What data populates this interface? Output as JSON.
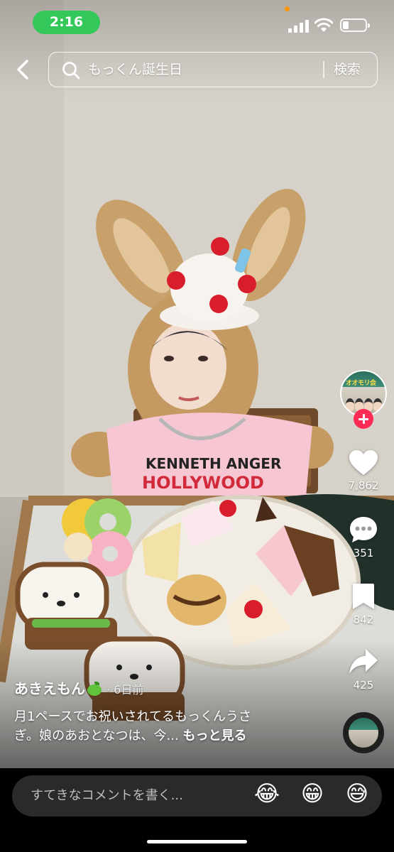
{
  "status_bar": {
    "time": "2:16"
  },
  "search": {
    "query": "もっくん誕生日",
    "submit_label": "検索"
  },
  "actions": {
    "likes": "7,862",
    "comments": "351",
    "bookmarks": "842",
    "shares": "425"
  },
  "avatar": {
    "title": "オオモリ会"
  },
  "post": {
    "author": "あきえもん",
    "date": "· 6日前",
    "caption_line1": "月1ペースでお祝いされてるもっくんうさ",
    "caption_line2": "ぎ。娘のあおとなつは、今...",
    "more_label": "もっと見る"
  },
  "comment_bar": {
    "placeholder": "すてきなコメントを書く...",
    "emojis": [
      "😂",
      "😁",
      "😅"
    ]
  },
  "colors": {
    "time_pill": "#34c759",
    "follow": "#fe2c55",
    "comment_field": "#2a2a2a"
  }
}
